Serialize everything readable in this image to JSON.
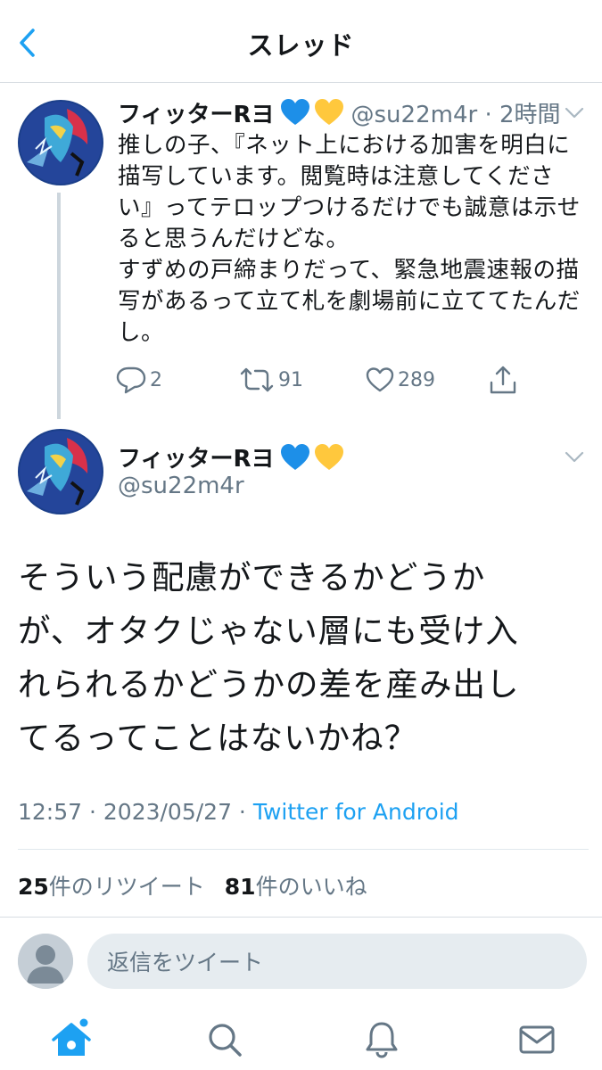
{
  "header": {
    "title": "スレッド"
  },
  "tweet1": {
    "name": "フィッターRヨ",
    "handle_time": "@su22m4r · 2時間",
    "text": "推しの子、『ネット上における加害を明白に\n描写しています。閲覧時は注意してくださ\nい』ってテロップつけるだけでも誠意は示せ\nると思うんだけどな。\nすずめの戸締まりだって、緊急地震速報の描\n写があるって立て札を劇場前に立ててたんだ\nし。",
    "replies": "2",
    "retweets": "91",
    "likes": "289"
  },
  "tweet2": {
    "name": "フィッターRヨ",
    "handle": "@su22m4r",
    "text": "そういう配慮ができるかどうか\nが、オタクじゃない層にも受け入\nれられるかどうかの差を産み出し\nてるってことはないかね？",
    "time": "12:57 · 2023/05/27 · ",
    "source": "Twitter for Android",
    "retweet_count": "25",
    "retweet_label": "件のリツイート",
    "like_count": "81",
    "like_label": "件のいいね"
  },
  "reply": {
    "placeholder": "返信をツイート"
  },
  "colors": {
    "accent": "#1da1f2",
    "secondary_text": "#657786",
    "heart_blue": "#1d8fe8",
    "heart_yellow": "#ffc83d"
  },
  "icons": [
    "back-arrow-icon",
    "chevron-down-icon",
    "reply-icon",
    "retweet-icon",
    "like-icon",
    "share-icon",
    "home-icon",
    "search-icon",
    "notifications-icon",
    "messages-icon"
  ]
}
